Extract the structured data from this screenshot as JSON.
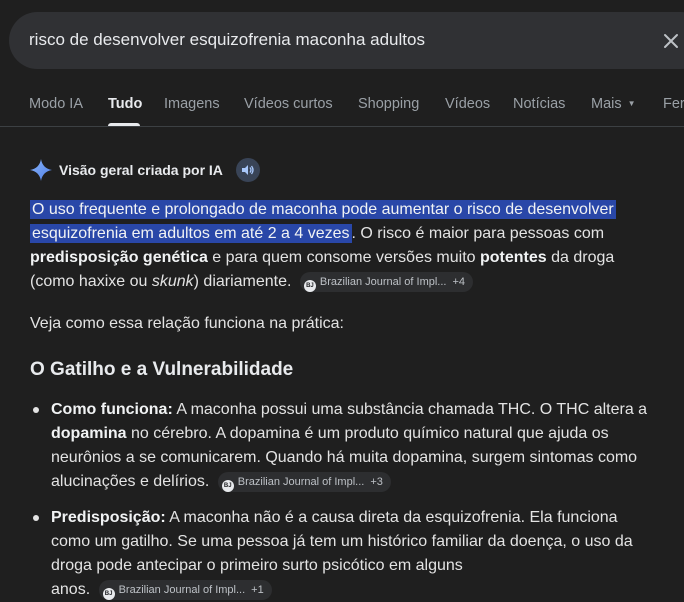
{
  "search": {
    "query": "risco de desenvolver esquizofrenia maconha adultos"
  },
  "tabs": [
    {
      "label": "Modo IA"
    },
    {
      "label": "Tudo"
    },
    {
      "label": "Imagens"
    },
    {
      "label": "Vídeos curtos"
    },
    {
      "label": "Shopping"
    },
    {
      "label": "Vídeos"
    },
    {
      "label": "Notícias"
    },
    {
      "label": "Mais"
    },
    {
      "label": "Fer"
    }
  ],
  "ai_overview": {
    "title": "Visão geral criada por IA",
    "p1": {
      "highlight_1": "O uso frequente e prolongado de maconha pode aumentar o risco de desenvolver",
      "highlight_2": "esquizofrenia em adultos em até 2 a 4 vezes",
      "t1": ". O risco é maior para pessoas com",
      "b1": "predisposição genética",
      "t2": " e para quem consome versões muito ",
      "b2": "potentes",
      "t3": " da droga",
      "t4": "(como haxixe ou ",
      "i1": "skunk",
      "t5": ") diariamente.",
      "chip": {
        "source": "Brazilian Journal of Impl...",
        "count": "+4"
      }
    },
    "p2": "Veja como essa relação funciona na prática:",
    "heading": "O Gatilho e a Vulnerabilidade",
    "items": [
      {
        "bold": "Como funciona:",
        "l1": " A maconha possui uma substância chamada THC. O THC altera a",
        "l2_bold": "dopamina",
        "l2": " no cérebro. A dopamina é um produto químico natural que ajuda os",
        "l3": "neurônios a se comunicarem. Quando há muita dopamina, surgem sintomas como",
        "l4": "alucinações e delírios.",
        "chip": {
          "source": "Brazilian Journal of Impl...",
          "count": "+3"
        }
      },
      {
        "bold": "Predisposição:",
        "l1": " A maconha não é a causa direta da esquizofrenia. Ela funciona",
        "l2": "como um gatilho. Se uma pessoa já tem um histórico familiar da doença, o uso da",
        "l3": "droga pode antecipar o primeiro surto psicótico em alguns",
        "l4": "anos.",
        "chip": {
          "source": "Brazilian Journal of Impl...",
          "count": "+1"
        }
      }
    ]
  }
}
